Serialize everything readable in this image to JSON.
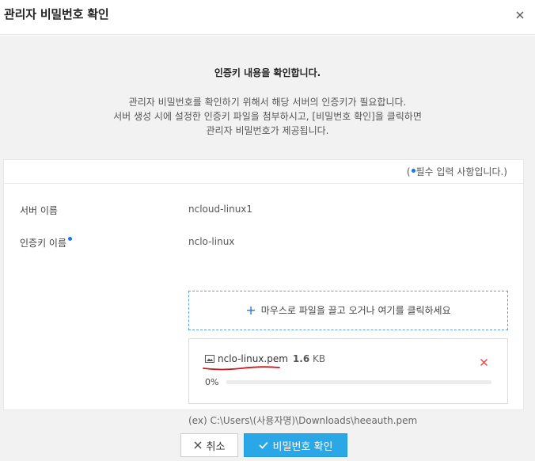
{
  "modal": {
    "title": "관리자 비밀번호 확인"
  },
  "intro": {
    "heading": "인증키 내용을 확인합니다.",
    "lines": [
      "관리자 비밀번호를 확인하기 위해서 해당 서버의 인증키가 필요합니다.",
      "서버 생성 시에 설정한 인증키 파일을 첨부하시고, [비밀번호 확인]을 클릭하면",
      "관리자 비밀번호가 제공됩니다."
    ]
  },
  "form": {
    "required_note_prefix": "(",
    "required_note_suffix": "필수 입력 사항입니다.)",
    "server_name_label": "서버 이름",
    "server_name_value": "ncloud-linux1",
    "auth_key_label": "인증키 이름",
    "auth_key_value": "nclo-linux",
    "dropzone_text": "마우스로 파일을 끌고 오거나 여기를 클릭하세요",
    "file": {
      "name": "nclo-linux.pem",
      "size_value": "1.6",
      "size_unit": "KB",
      "progress_label": "0%",
      "progress_fraction": 0
    },
    "path_hint": "(ex) C:\\Users\\(사용자명)\\Downloads\\heeauth.pem"
  },
  "footer": {
    "cancel_label": "취소",
    "confirm_label": "비밀번호 확인"
  },
  "colors": {
    "accent": "#1a73e8",
    "confirm_button": "#29a7e6",
    "remove_icon": "#e24a4a",
    "annotation_underline": "#d11a1a"
  },
  "icons": {
    "close": "close-icon",
    "plus": "plus-icon",
    "file": "image-file-icon",
    "remove": "remove-x-icon",
    "cancel": "x-icon",
    "confirm": "check-icon"
  }
}
